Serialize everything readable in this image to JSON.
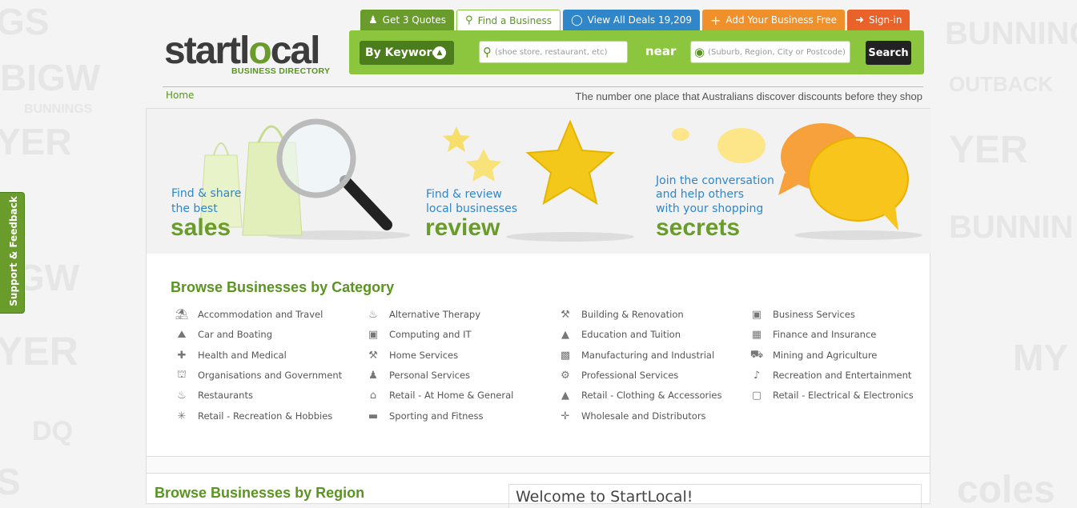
{
  "tabs": [
    {
      "label": "Get 3 Quotes",
      "icon": "quote-person-icon"
    },
    {
      "label": "Find a Business",
      "icon": "search-icon"
    },
    {
      "label": "View All Deals 19,209",
      "icon": "tag-icon"
    },
    {
      "label": "Add Your Business Free",
      "icon": "plus-icon"
    },
    {
      "label": "Sign-in",
      "icon": "signin-icon"
    }
  ],
  "search": {
    "mode_label": "By Keyword",
    "keyword_placeholder": "(shoe store, restaurant, etc)",
    "near_label": "near",
    "location_placeholder": "(Suburb, Region, City or Postcode)",
    "button_label": "Search"
  },
  "logo": {
    "main_a": "startl",
    "main_o": "o",
    "main_b": "cal",
    "sub": "BUSINESS DIRECTORY"
  },
  "breadcrumb": {
    "home": "Home"
  },
  "tagline": "The number one place that Australians discover discounts before they shop",
  "banners": [
    {
      "line1": "Find & share",
      "line2": "the best",
      "big": "sales"
    },
    {
      "line1": "Find & review",
      "line2": "local businesses",
      "big": "review"
    },
    {
      "line1": "Join the conversation",
      "line2": "and help others",
      "line3": "with your shopping",
      "big": "secrets"
    }
  ],
  "categories": {
    "title": "Browse Businesses by Category",
    "items": [
      {
        "label": "Accommodation and Travel",
        "icon": "beach-umbrella-icon"
      },
      {
        "label": "Car and Boating",
        "icon": "car-icon"
      },
      {
        "label": "Health and Medical",
        "icon": "medical-kit-icon"
      },
      {
        "label": "Organisations and Government",
        "icon": "government-building-icon"
      },
      {
        "label": "Restaurants",
        "icon": "cutlery-icon"
      },
      {
        "label": "Retail - Recreation & Hobbies",
        "icon": "puzzle-icon"
      },
      {
        "label": "Alternative Therapy",
        "icon": "therapy-bowl-icon"
      },
      {
        "label": "Computing and IT",
        "icon": "computer-icon"
      },
      {
        "label": "Home Services",
        "icon": "tools-icon"
      },
      {
        "label": "Personal Services",
        "icon": "person-icon"
      },
      {
        "label": "Retail - At Home & General",
        "icon": "house-icon"
      },
      {
        "label": "Sporting and Fitness",
        "icon": "dumbbell-icon"
      },
      {
        "label": "Building & Renovation",
        "icon": "hammer-icon"
      },
      {
        "label": "Education and Tuition",
        "icon": "graduation-cap-icon"
      },
      {
        "label": "Manufacturing and Industrial",
        "icon": "factory-icon"
      },
      {
        "label": "Professional Services",
        "icon": "gears-icon"
      },
      {
        "label": "Retail - Clothing & Accessories",
        "icon": "tshirt-icon"
      },
      {
        "label": "Wholesale and Distributors",
        "icon": "distribution-arrows-icon"
      },
      {
        "label": "Business Services",
        "icon": "briefcase-icon"
      },
      {
        "label": "Finance and Insurance",
        "icon": "calculator-icon"
      },
      {
        "label": "Mining and Agriculture",
        "icon": "tractor-icon"
      },
      {
        "label": "Recreation and Entertainment",
        "icon": "microphone-icon"
      },
      {
        "label": "Retail - Electrical & Electronics",
        "icon": "tv-icon"
      }
    ]
  },
  "regions": {
    "title": "Browse Businesses by Region"
  },
  "welcome": {
    "title": "Welcome to StartLocal!"
  },
  "feedback": {
    "label": "Support & Feedback"
  },
  "watermarks": [
    "GS",
    "BIGW",
    "BUNNINGS",
    "YER",
    "S",
    "GW",
    "YER",
    "DQ",
    "S",
    "BUNNINGS",
    "OUTBACK",
    "YER",
    "BUNNIN",
    "MY",
    "coles"
  ]
}
